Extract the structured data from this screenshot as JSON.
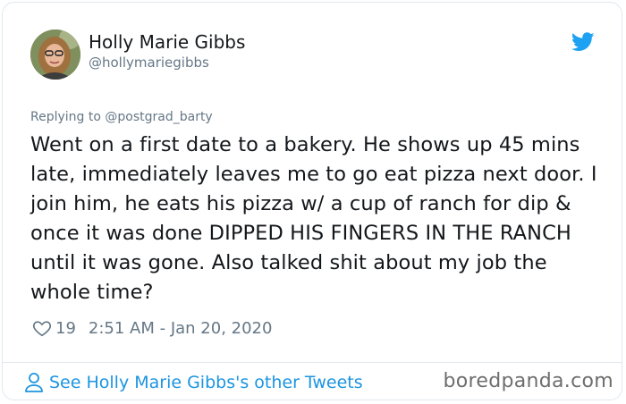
{
  "author": {
    "name": "Holly Marie Gibbs",
    "handle": "@hollymariegibbs",
    "avatar_icon": "avatar-photo"
  },
  "brand_icon": "twitter-bird-icon",
  "reply_to": "Replying to @postgrad_barty",
  "tweet": {
    "text": "Went on a first date to a bakery. He shows up 45 mins late, immediately leaves me to go eat pizza next door. I join him, he eats his pizza w/ a cup of ranch for dip & once it was done DIPPED HIS FINGERS IN THE RANCH until it was gone. Also talked shit about my job the whole time?",
    "likes": "19",
    "timestamp": "2:51 AM - Jan 20, 2020"
  },
  "footer": {
    "see_more": "See Holly Marie Gibbs's other Tweets",
    "watermark": "boredpanda.com"
  },
  "colors": {
    "text": "#14171a",
    "muted": "#657786",
    "accent": "#1b95e0",
    "border": "#e1e8ed"
  }
}
